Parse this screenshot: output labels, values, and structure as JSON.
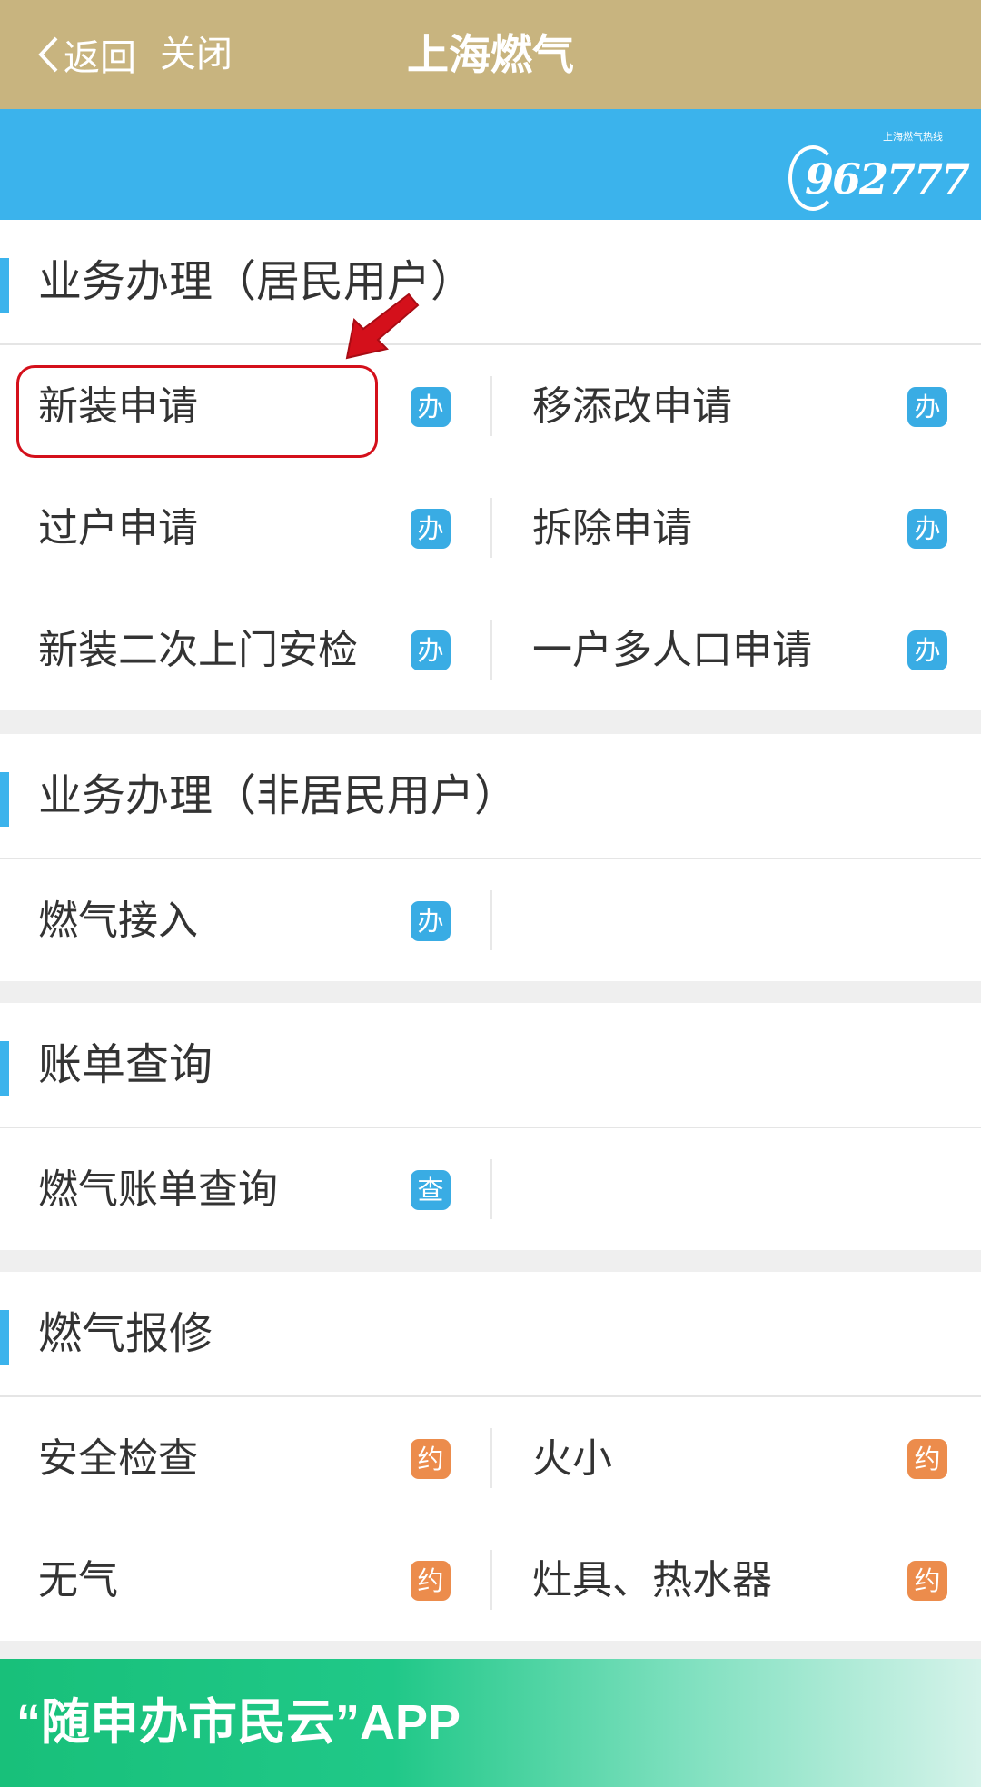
{
  "nav": {
    "back_label": "返回",
    "close_label": "关闭",
    "title": "上海燃气"
  },
  "banner": {
    "logo_text": "962777",
    "logo_caption": "上海燃气热线"
  },
  "sections": [
    {
      "title": "业务办理（居民用户）",
      "rows": [
        [
          {
            "label": "新装申请",
            "badge": "办",
            "badge_color": "#39ace4"
          },
          {
            "label": "移添改申请",
            "badge": "办",
            "badge_color": "#39ace4"
          }
        ],
        [
          {
            "label": "过户申请",
            "badge": "办",
            "badge_color": "#39ace4"
          },
          {
            "label": "拆除申请",
            "badge": "办",
            "badge_color": "#39ace4"
          }
        ],
        [
          {
            "label": "新装二次上门安检",
            "badge": "办",
            "badge_color": "#39ace4"
          },
          {
            "label": "一户多人口申请",
            "badge": "办",
            "badge_color": "#39ace4"
          }
        ]
      ]
    },
    {
      "title": "业务办理（非居民用户）",
      "rows": [
        [
          {
            "label": "燃气接入",
            "badge": "办",
            "badge_color": "#39ace4"
          }
        ]
      ]
    },
    {
      "title": "账单查询",
      "rows": [
        [
          {
            "label": "燃气账单查询",
            "badge": "查",
            "badge_color": "#39ace4"
          }
        ]
      ]
    },
    {
      "title": "燃气报修",
      "rows": [
        [
          {
            "label": "安全检查",
            "badge": "约",
            "badge_color": "#ec8c4c"
          },
          {
            "label": "火小",
            "badge": "约",
            "badge_color": "#ec8c4c"
          }
        ],
        [
          {
            "label": "无气",
            "badge": "约",
            "badge_color": "#ec8c4c"
          },
          {
            "label": "灶具、热水器",
            "badge": "约",
            "badge_color": "#ec8c4c"
          }
        ]
      ]
    }
  ],
  "bottom_banner": {
    "text": "“随申办市民云”APP"
  },
  "colors": {
    "nav_bg": "#c8b47f",
    "banner_bg": "#3bb3ec",
    "accent_blue": "#39ace4",
    "accent_orange": "#ec8c4c",
    "highlight_red": "#d4101b"
  }
}
